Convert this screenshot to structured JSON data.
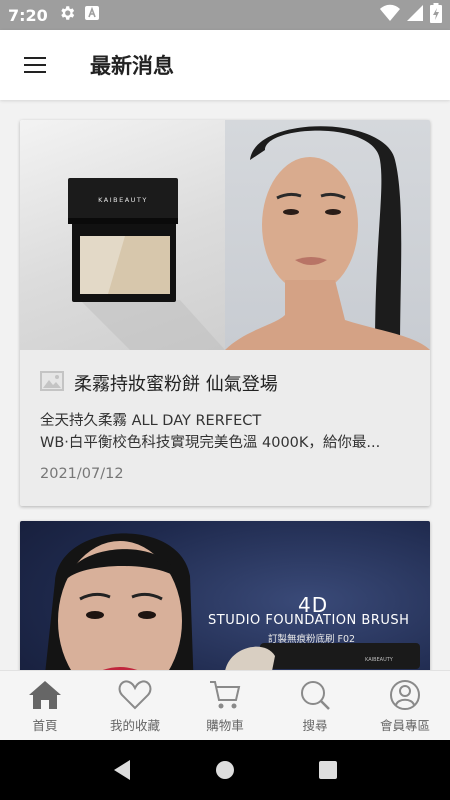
{
  "status_bar": {
    "time": "7:20",
    "icons": [
      "settings-icon",
      "a-badge-icon",
      "wifi-icon",
      "signal-icon",
      "battery-icon"
    ]
  },
  "app_bar": {
    "menu_icon": "menu-icon",
    "title": "最新消息"
  },
  "cards": [
    {
      "image_brand_text": "KAIBEAUTY",
      "title": "柔霧持妝蜜粉餅 仙氣登場",
      "title_icon": "image-icon",
      "description_line1": "全天持久柔霧 ALL DAY RERFECT",
      "description_line2": "WB‧白平衡校色科技實現完美色溫 4000K，給你最...",
      "date": "2021/07/12"
    },
    {
      "banner_headline": "4D",
      "banner_title": "STUDIO FOUNDATION BRUSH",
      "banner_subtitle": "訂製無痕粉底刷 F02",
      "banner_brand": "KAIBEAUTY"
    }
  ],
  "bottom_nav": [
    {
      "label": "首頁",
      "icon": "home-icon",
      "active": true
    },
    {
      "label": "我的收藏",
      "icon": "heart-icon",
      "active": false
    },
    {
      "label": "購物車",
      "icon": "cart-icon",
      "active": false
    },
    {
      "label": "搜尋",
      "icon": "search-icon",
      "active": false
    },
    {
      "label": "會員專區",
      "icon": "user-icon",
      "active": false
    }
  ],
  "colors": {
    "status_bar_bg": "#9e9e9e",
    "app_bar_bg": "#ffffff",
    "card_bg": "#ececec",
    "nav_icon": "#8a8a8a",
    "nav_icon_active": "#666666"
  }
}
